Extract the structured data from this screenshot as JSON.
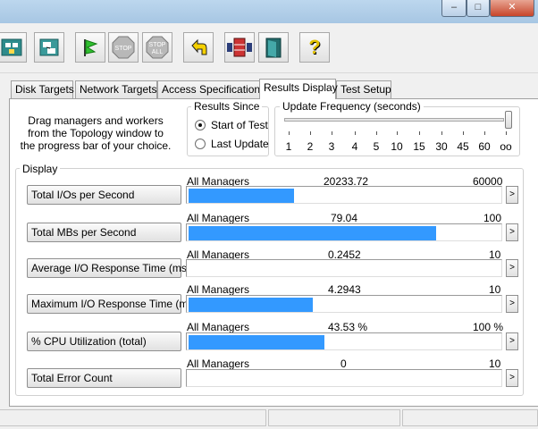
{
  "window": {
    "minimize_glyph": "–",
    "maximize_glyph": "□",
    "close_glyph": "✕"
  },
  "toolbar": {
    "stop_label": "STOP",
    "stop_all_label1": "STOP",
    "stop_all_label2": "ALL",
    "help_glyph": "?"
  },
  "tabs": [
    {
      "label": "Disk Targets"
    },
    {
      "label": "Network Targets"
    },
    {
      "label": "Access Specifications"
    },
    {
      "label": "Results Display"
    },
    {
      "label": "Test Setup"
    }
  ],
  "active_tab": "Results Display",
  "help_text": "Drag managers and workers from the Topology window to the progress bar of your choice.",
  "results_since": {
    "title": "Results Since",
    "options": [
      "Start of Test",
      "Last Update"
    ],
    "selected": "Start of Test"
  },
  "update_frequency": {
    "title": "Update Frequency (seconds)",
    "ticks": [
      "1",
      "2",
      "3",
      "4",
      "5",
      "10",
      "15",
      "30",
      "45",
      "60",
      "oo"
    ],
    "selected": "oo"
  },
  "display": {
    "title": "Display",
    "arrow_glyph": ">",
    "rows": [
      {
        "label": "Total I/Os per Second",
        "source": "All Managers",
        "value": "20233.72",
        "max": "60000",
        "fraction": 0.337
      },
      {
        "label": "Total MBs per Second",
        "source": "All Managers",
        "value": "79.04",
        "max": "100",
        "fraction": 0.7904
      },
      {
        "label": "Average I/O Response Time (ms)",
        "source": "All Managers",
        "value": "0.2452",
        "max": "10",
        "fraction": 0.0
      },
      {
        "label": "Maximum I/O Response Time (ms)",
        "source": "All Managers",
        "value": "4.2943",
        "max": "10",
        "fraction": 0.3971
      },
      {
        "label": "% CPU Utilization (total)",
        "source": "All Managers",
        "value": "43.53 %",
        "max": "100 %",
        "fraction": 0.4353
      },
      {
        "label": "Total Error Count",
        "source": "All Managers",
        "value": "0",
        "max": "10",
        "fraction": 0.0
      }
    ]
  }
}
